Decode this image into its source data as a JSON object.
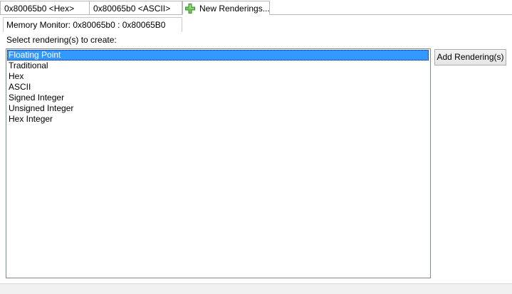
{
  "tabs": [
    {
      "label": "0x80065b0 <Hex>",
      "active": false
    },
    {
      "label": "0x80065b0 <ASCII>",
      "active": false
    },
    {
      "label": "New Renderings...",
      "active": true,
      "icon": "plus-icon",
      "icon_color": "#5cb85c"
    }
  ],
  "monitor": {
    "header": "Memory Monitor: 0x80065b0 : 0x80065B0"
  },
  "renderings": {
    "prompt": "Select rendering(s) to create:",
    "selected_index": 0,
    "items": [
      "Floating Point",
      "Traditional",
      "Hex",
      "ASCII",
      "Signed Integer",
      "Unsigned Integer",
      "Hex Integer"
    ]
  },
  "add_button": {
    "label": "Add Rendering(s)"
  },
  "colors": {
    "selection": "#3399ff",
    "selection_text": "#ffffff"
  }
}
